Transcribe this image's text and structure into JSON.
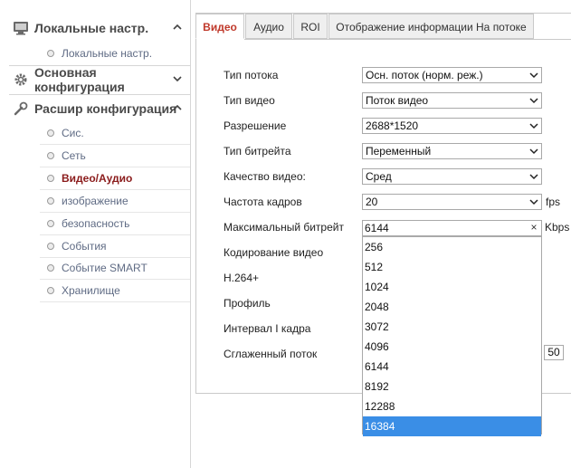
{
  "sidebar": {
    "local": {
      "label": "Локальные настр.",
      "items": [
        "Локальные настр."
      ]
    },
    "basic": {
      "label": "Основная конфигурация"
    },
    "advanced": {
      "label": "Расшир конфигурация",
      "items": [
        "Сис.",
        "Сеть",
        "Видео/Аудио",
        "изображение",
        "безопасность",
        "События",
        "Событие SMART",
        "Хранилище"
      ],
      "active": "Видео/Аудио"
    }
  },
  "tabs": [
    "Видео",
    "Аудио",
    "ROI",
    "Отображение информации На потоке"
  ],
  "active_tab": "Видео",
  "form": {
    "stream_type": {
      "label": "Тип потока",
      "value": "Осн. поток (норм. реж.)"
    },
    "video_type": {
      "label": "Тип видео",
      "value": "Поток видео"
    },
    "resolution": {
      "label": "Разрешение",
      "value": "2688*1520"
    },
    "bitrate_type": {
      "label": "Тип битрейта",
      "value": "Переменный"
    },
    "video_quality": {
      "label": "Качество видео:",
      "value": "Сред"
    },
    "frame_rate": {
      "label": "Частота кадров",
      "value": "20",
      "unit": "fps"
    },
    "max_bitrate": {
      "label": "Максимальный битрейт",
      "value": "6144",
      "unit": "Kbps",
      "clear": "×"
    },
    "video_encoding": {
      "label": "Кодирование видео"
    },
    "h264plus": {
      "label": "H.264+"
    },
    "profile": {
      "label": "Профиль"
    },
    "i_frame_interval": {
      "label": "Интервал I кадра"
    },
    "smooth_stream": {
      "label": "Сглаженный поток",
      "value": "50"
    }
  },
  "bitrate_options": [
    "256",
    "512",
    "1024",
    "2048",
    "3072",
    "4096",
    "6144",
    "8192",
    "12288",
    "16384"
  ],
  "bitrate_highlighted": "16384",
  "colors": {
    "accent": "#c0392b",
    "active_nav": "#8b1c1c",
    "highlight": "#3a8ee6"
  }
}
